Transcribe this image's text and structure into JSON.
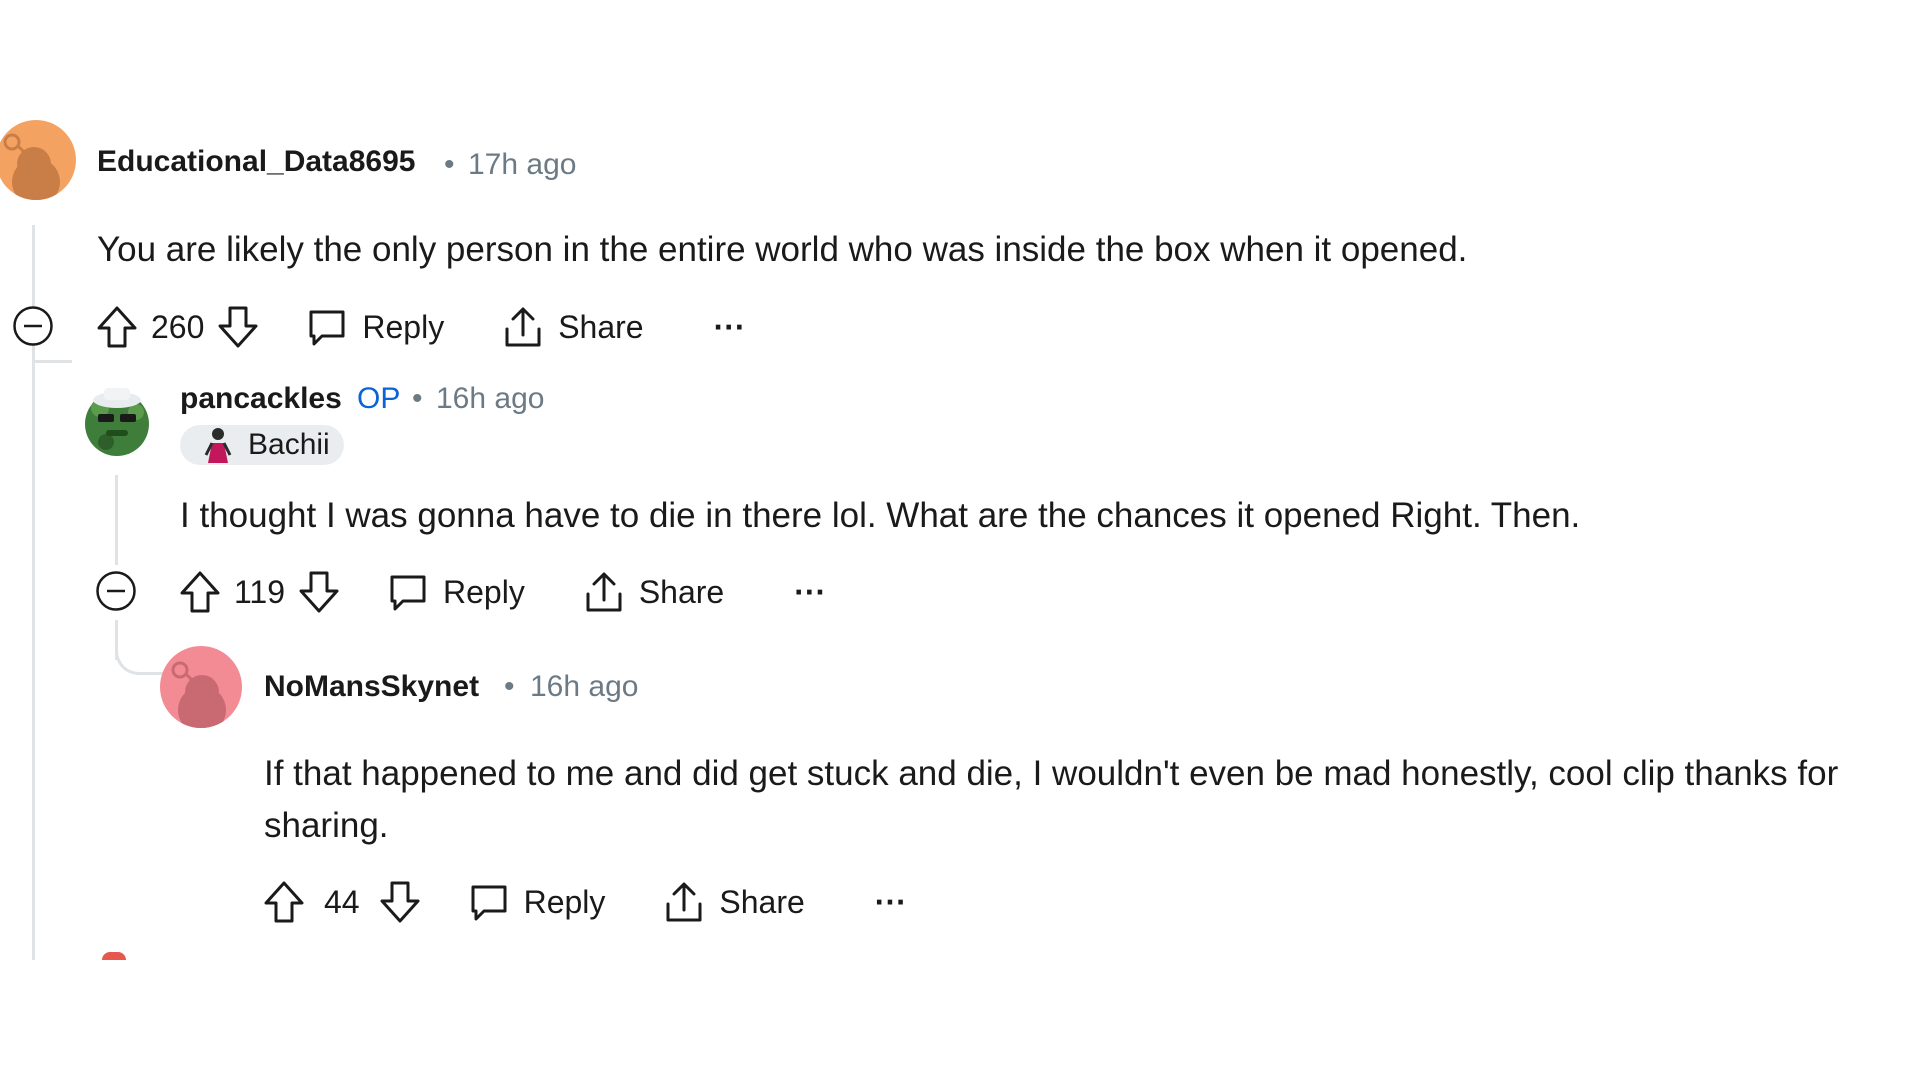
{
  "comments": [
    {
      "username": "Educational_Data8695",
      "separator": "•",
      "time": "17h ago",
      "text": "You are likely the only person in the entire world who was inside the box when it opened.",
      "votes": "260",
      "reply_label": "Reply",
      "share_label": "Share",
      "more_label": "···",
      "avatar_color": "#f4a261"
    },
    {
      "username": "pancackles",
      "op_badge": "OP",
      "separator": "•",
      "time": "16h ago",
      "flair": "Bachii",
      "text": "I thought I was gonna have to die in there lol. What are the chances it opened Right. Then.",
      "votes": "119",
      "reply_label": "Reply",
      "share_label": "Share",
      "more_label": "···",
      "avatar_color": "#3f7d3a"
    },
    {
      "username": "NoMansSkynet",
      "separator": "•",
      "time": "16h ago",
      "text_line1": "If that happened to me and did get stuck and die, I wouldn't even be mad honestly, cool clip thanks for",
      "text_line2": "sharing.",
      "votes": "44",
      "reply_label": "Reply",
      "share_label": "Share",
      "more_label": "···",
      "avatar_color": "#f28b94"
    }
  ],
  "colors": {
    "line": "#e0e3e6",
    "meta": "#6b7a85",
    "op": "#0b63d6",
    "accent_red": "#e8574b"
  }
}
